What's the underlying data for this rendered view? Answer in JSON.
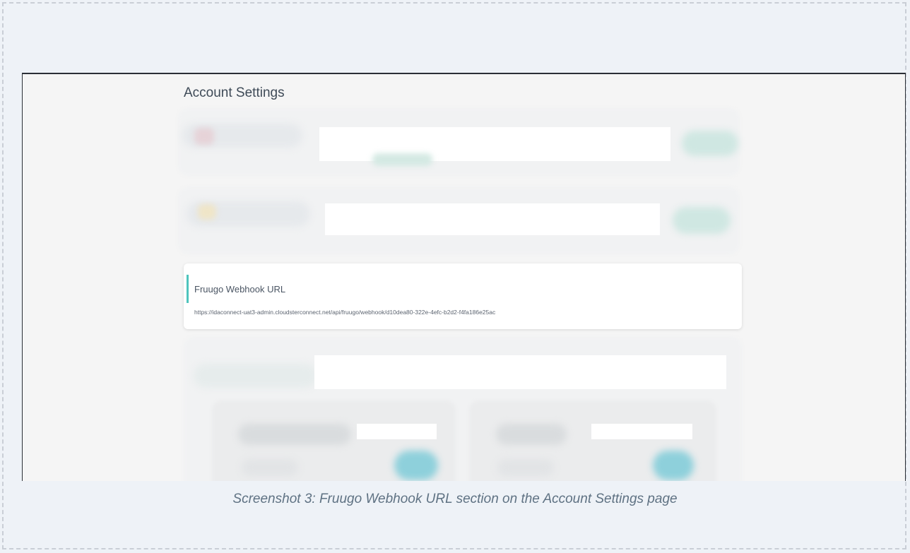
{
  "page": {
    "title": "Account Settings"
  },
  "webhook": {
    "label": "Fruugo Webhook URL",
    "url": "https://idaconnect-uat3-admin.cloudsterconnect.net/api/fruugo/webhook/d10dea80-322e-4efc-b2d2-f4fa186e25ac",
    "accent_color": "#4ec4bd"
  },
  "caption": "Screenshot 3: Fruugo Webhook URL section on the Account Settings page"
}
